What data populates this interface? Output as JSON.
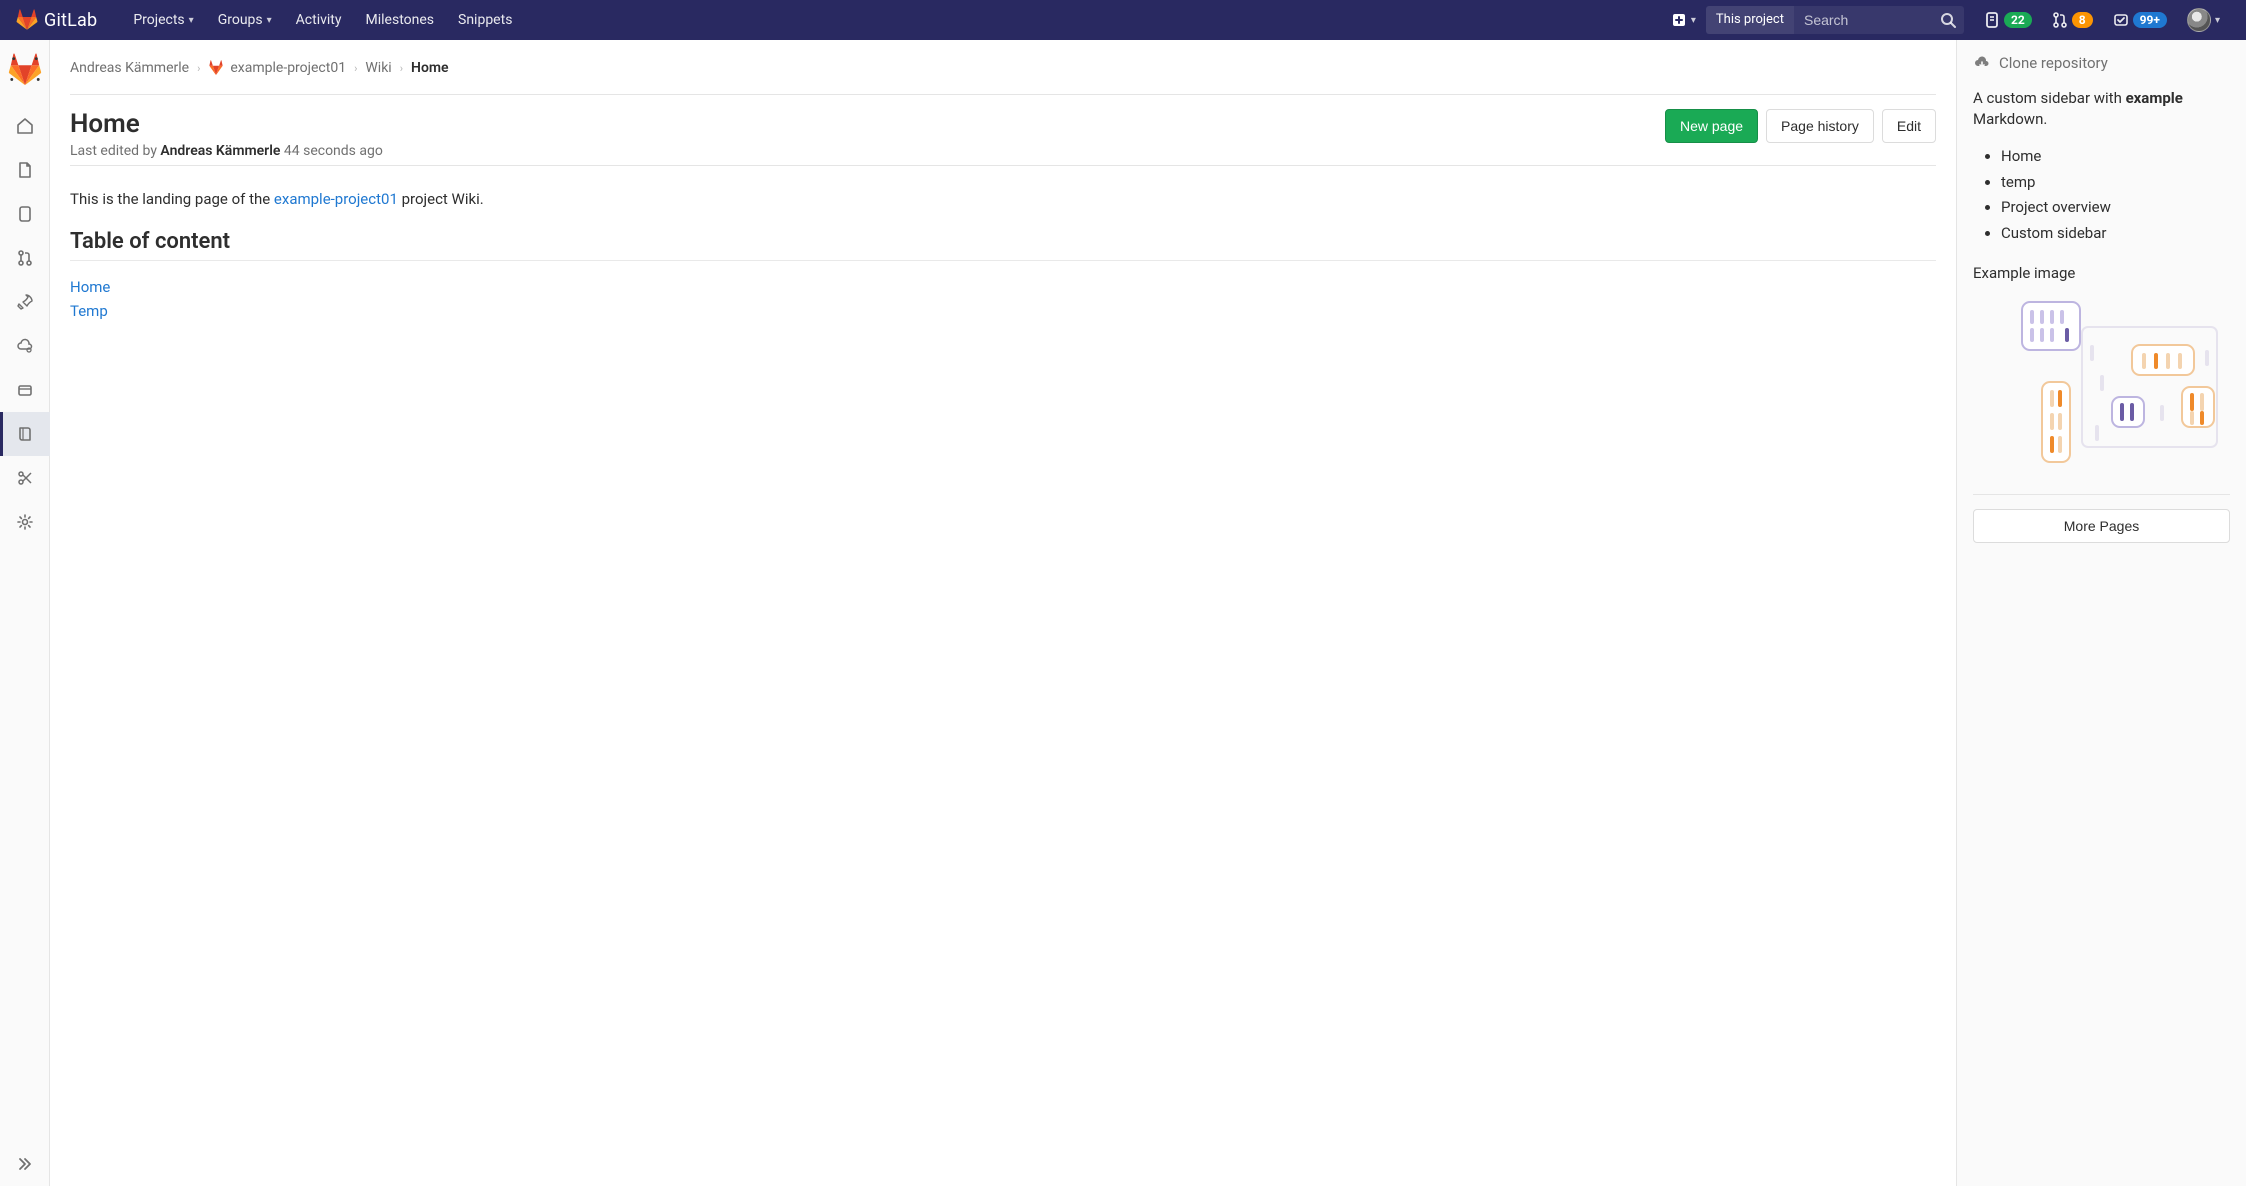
{
  "brand": {
    "name": "GitLab"
  },
  "topnav": {
    "items": [
      "Projects",
      "Groups",
      "Activity",
      "Milestones",
      "Snippets"
    ],
    "search_scope": "This project",
    "search_placeholder": "Search",
    "issues_count": "22",
    "mrs_count": "8",
    "todos_count": "99+"
  },
  "breadcrumbs": {
    "owner": "Andreas Kämmerle",
    "project": "example-project01",
    "section": "Wiki",
    "page": "Home"
  },
  "page": {
    "title": "Home",
    "last_edited_prefix": "Last edited by ",
    "last_edited_by": "Andreas Kämmerle",
    "last_edited_ago": " 44 seconds ago",
    "actions": {
      "new": "New page",
      "history": "Page history",
      "edit": "Edit"
    },
    "intro_prefix": "This is the landing page of the ",
    "intro_link": "example-project01",
    "intro_suffix": " project Wiki.",
    "toc_heading": "Table of content",
    "toc": [
      "Home",
      "Temp"
    ]
  },
  "sidebar": {
    "clone": "Clone repository",
    "custom_prefix": "A custom sidebar with ",
    "custom_bold": "example",
    "custom_suffix": " Markdown.",
    "links": [
      "Home",
      "temp",
      "Project overview",
      "Custom sidebar"
    ],
    "image_label": "Example image",
    "more": "More Pages"
  }
}
